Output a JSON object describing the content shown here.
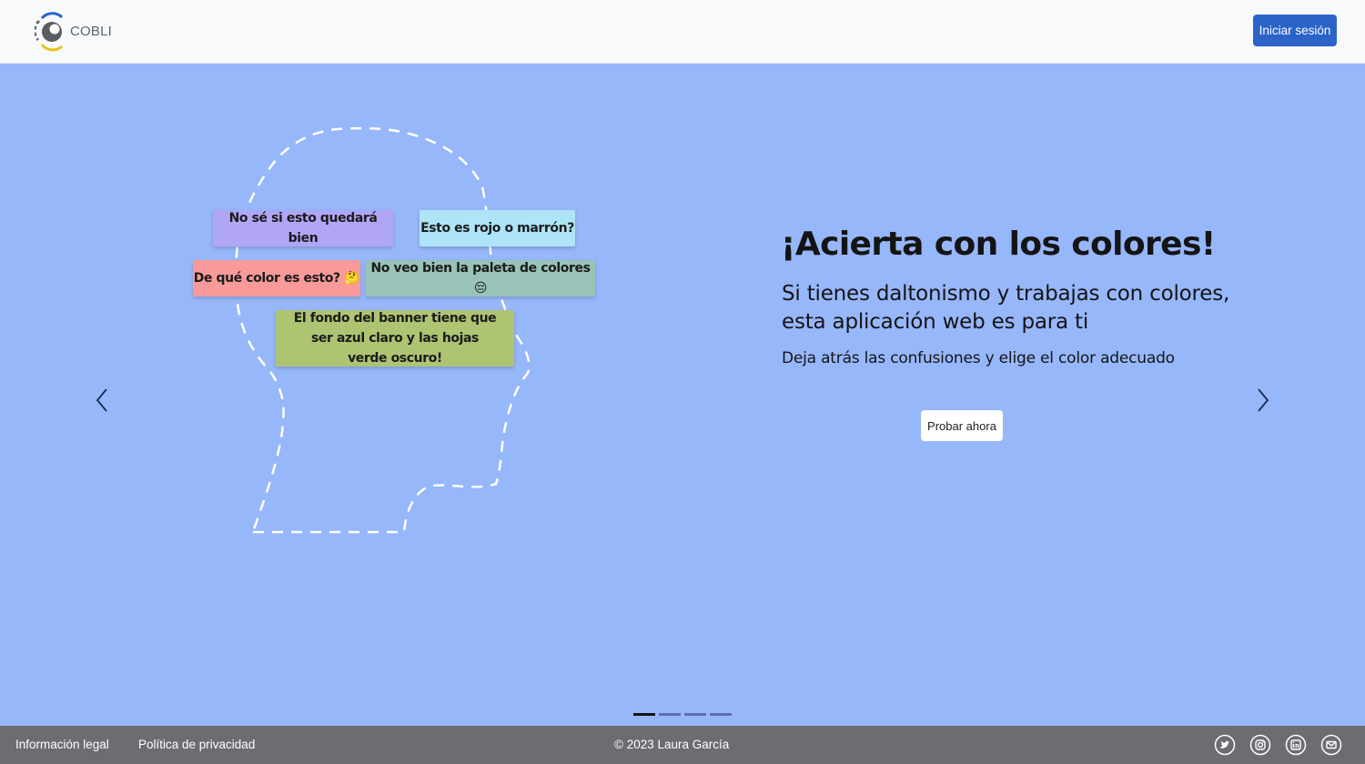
{
  "header": {
    "brand": "COBLI",
    "login_label": "Iniciar sesión"
  },
  "hero": {
    "notes": [
      "No sé si esto quedará bien",
      "Esto es rojo o marrón?",
      "De qué color es esto? 🤔",
      "No veo bien la paleta de colores 😔",
      "El fondo del banner tiene que ser azul claro y las hojas verde oscuro!"
    ],
    "title": "¡Acierta con los colores!",
    "subtitle": "Si tienes daltonismo y trabajas con colores, esta aplicación web es para ti",
    "description": "Deja atrás las confusiones y elige el color adecuado",
    "cta_label": "Probar ahora"
  },
  "carousel": {
    "slide_count": 4,
    "active_slide": 1
  },
  "footer": {
    "legal_label": "Información legal",
    "privacy_label": "Política de privacidad",
    "copyright": "© 2023 Laura García",
    "social_icons": [
      "twitter-icon",
      "instagram-icon",
      "linkedin-icon",
      "email-icon"
    ]
  },
  "colors": {
    "background": "#97b7fb",
    "primary_button": "#2b63c9",
    "footer": "#6c6d70",
    "note_purple": "#b1a6f6",
    "note_cyan": "#aee4f7",
    "note_red": "#f89a99",
    "note_teal": "#99c3b8",
    "note_green": "#aec473"
  }
}
